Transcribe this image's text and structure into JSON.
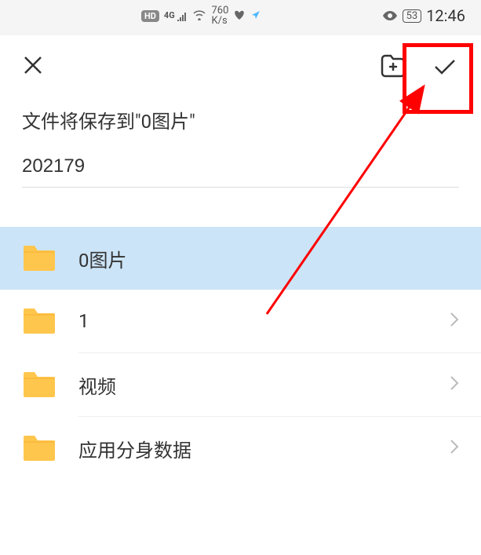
{
  "status_bar": {
    "hd_badge": "HD",
    "signal_label": "4G",
    "speed_value": "760",
    "speed_unit": "K/s",
    "battery_level": "53",
    "time": "12:46"
  },
  "header": {
    "save_label": "文件将保存到\"0图片\"",
    "filename": "202179"
  },
  "folders": [
    {
      "name": "0图片",
      "selected": true
    },
    {
      "name": "1",
      "selected": false
    },
    {
      "name": "视频",
      "selected": false
    },
    {
      "name": "应用分身数据",
      "selected": false
    }
  ],
  "icons": {
    "close": "close-icon",
    "new_folder": "new-folder-icon",
    "confirm": "checkmark-icon",
    "folder": "folder-icon",
    "chevron": "chevron-right-icon"
  }
}
